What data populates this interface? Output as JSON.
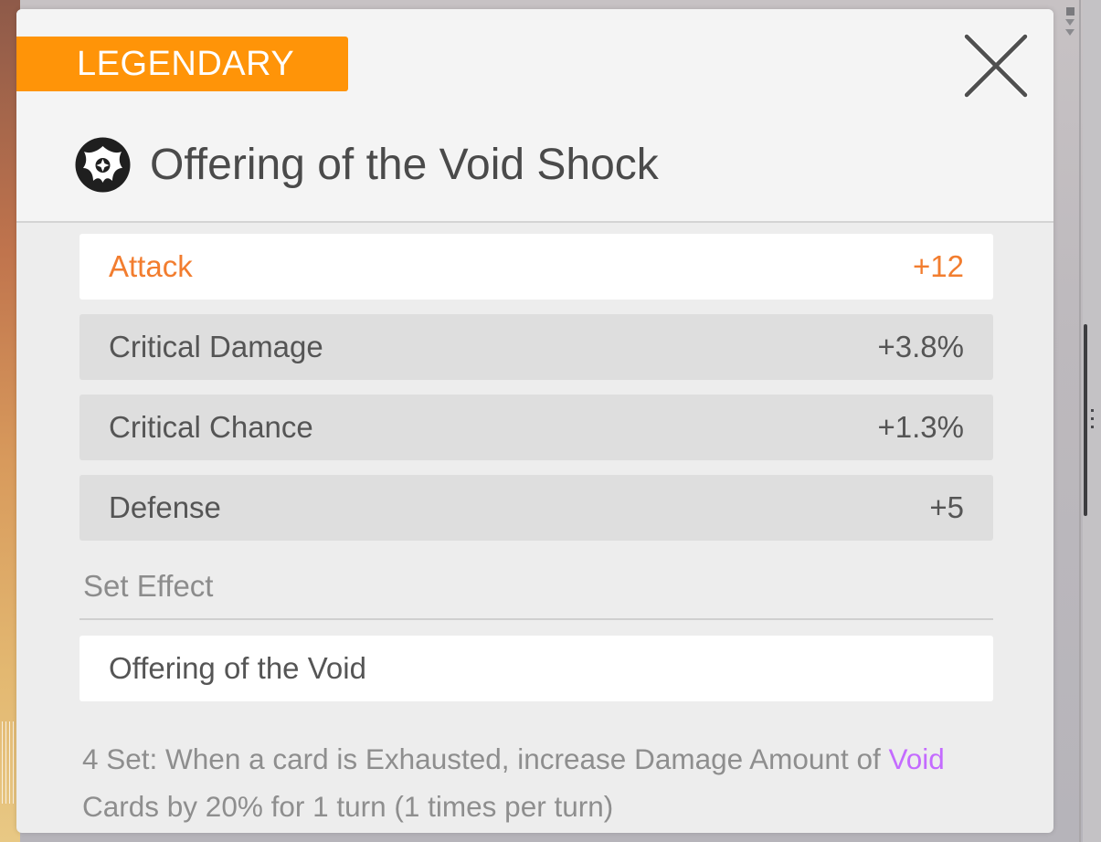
{
  "item": {
    "rarity": "LEGENDARY",
    "title": "Offering of the Void Shock",
    "icon": "void-sigil-icon"
  },
  "stats": [
    {
      "label": "Attack",
      "value": "+12",
      "highlight": true
    },
    {
      "label": "Critical Damage",
      "value": "+3.8%",
      "highlight": false
    },
    {
      "label": "Critical Chance",
      "value": "+1.3%",
      "highlight": false
    },
    {
      "label": "Defense",
      "value": "+5",
      "highlight": false
    }
  ],
  "set_effect": {
    "section_label": "Set Effect",
    "name": "Offering of the Void",
    "desc_before": "4 Set: When a card is Exhausted, increase Damage Amount of ",
    "desc_keyword": "Void",
    "desc_after": " Cards by 20% for 1 turn (1 times per turn)"
  },
  "colors": {
    "rarity_badge": "#ff9408",
    "highlight_text": "#f27d2f",
    "void_keyword": "#c46bff",
    "panel_bg": "#ededed"
  },
  "icons": {
    "close": "close-x-icon"
  }
}
